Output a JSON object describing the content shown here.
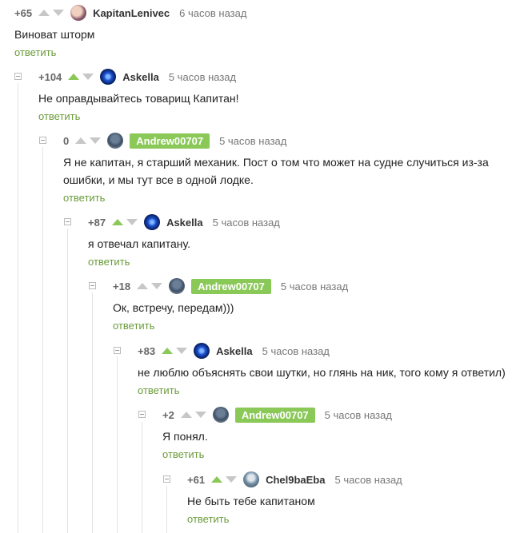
{
  "reply_label": "ответить",
  "comments": [
    {
      "rating": "+65",
      "author": "KapitanLenivec",
      "time": "6 часов назад",
      "text": "Виноват шторм",
      "up_active": false
    },
    {
      "rating": "+104",
      "author": "Askella",
      "time": "5 часов назад",
      "text": "Не оправдывайтесь товарищ Капитан!",
      "up_active": true
    },
    {
      "rating": "0",
      "author": "Andrew00707",
      "time": "5 часов назад",
      "text_line1": "Я не капитан, я старший механик. Пост о том что может на судне случиться из-за",
      "text_line2": "ошибки, и мы тут все в одной лодке.",
      "up_active": false
    },
    {
      "rating": "+87",
      "author": "Askella",
      "time": "5 часов назад",
      "text": "я отвечал капитану.",
      "up_active": true
    },
    {
      "rating": "+18",
      "author": "Andrew00707",
      "time": "5 часов назад",
      "text": "Ок, встречу, передам)))",
      "up_active": false
    },
    {
      "rating": "+83",
      "author": "Askella",
      "time": "5 часов назад",
      "text": "не люблю объяснять свои шутки, но глянь на ник, того кому я ответил)",
      "up_active": true
    },
    {
      "rating": "+2",
      "author": "Andrew00707",
      "time": "5 часов назад",
      "text": "Я понял.",
      "up_active": false
    },
    {
      "rating": "+61",
      "author": "Chel9baEba",
      "time": "5 часов назад",
      "text": "Не быть тебе капитаном",
      "up_active": true
    }
  ]
}
